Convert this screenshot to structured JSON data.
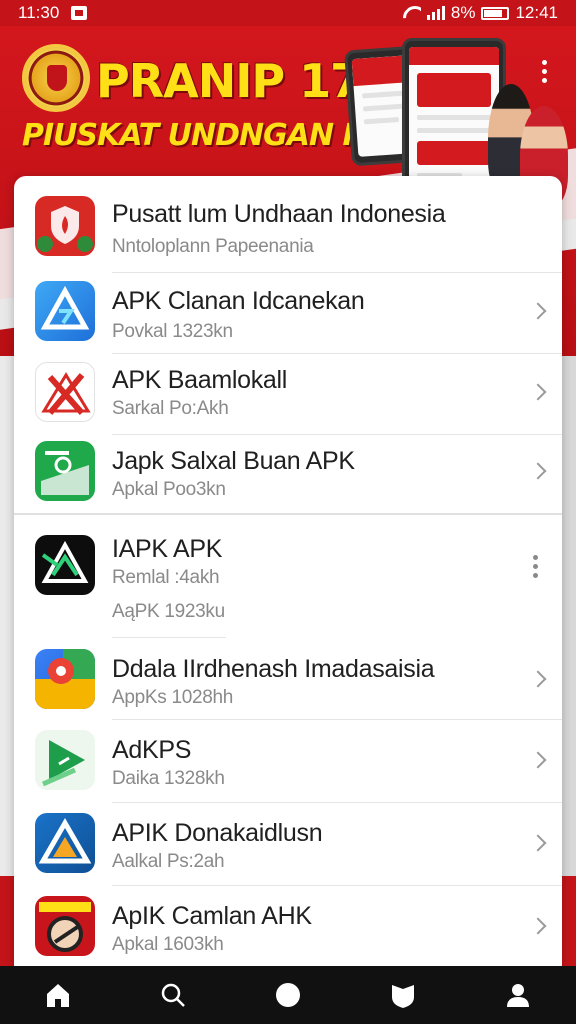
{
  "status_bar": {
    "time": "11:30",
    "battery_text": "8%",
    "clock_right": "12:41"
  },
  "banner": {
    "title": "PRANIP 17",
    "subtitle": "PIUSKAT UNDNGAN IIDONSIN"
  },
  "list": {
    "items": [
      {
        "name": "Pusatt lum Undhaan Indonesia",
        "sub": "Nntoloplann Papeenania",
        "icon": "shield-flame-icon",
        "action": "none"
      },
      {
        "name": "APK Clanan Idcanekan",
        "sub": "Povkal 1323kn",
        "icon": "blue-triangle-app-icon",
        "action": "chevron"
      },
      {
        "name": "APK Baamlokall",
        "sub": "Sarkal Po:Akh",
        "icon": "red-x-app-icon",
        "action": "chevron"
      },
      {
        "name": "Japk Salxal Buan APK",
        "sub": "Apkal Poo3kn",
        "icon": "green-card-app-icon",
        "action": "chevron"
      },
      {
        "name": "IAPK APK",
        "sub": "Remlal :4akh",
        "sub2": "AąPK 1923ku",
        "icon": "dark-triangle-app-icon",
        "action": "kebab"
      },
      {
        "name": "Ddala IIrdhenash Imadasaisia",
        "sub": "AppKs 1028hh",
        "icon": "map-pin-app-icon",
        "action": "chevron"
      },
      {
        "name": "AdKPS",
        "sub": "Daika 1328kh",
        "icon": "green-play-app-icon",
        "action": "chevron"
      },
      {
        "name": "APIK Donakaidlusn",
        "sub": "Aalkal Ps:2ah",
        "icon": "blue-delta-app-icon",
        "action": "chevron"
      },
      {
        "name": "ApIK Camlan AHK",
        "sub": "Apkal 1603kh",
        "icon": "red-poster-app-icon",
        "action": "chevron"
      }
    ]
  },
  "bottom_nav": {
    "items": [
      {
        "icon": "home-icon"
      },
      {
        "icon": "search-icon"
      },
      {
        "icon": "circle-icon"
      },
      {
        "icon": "shield-icon"
      },
      {
        "icon": "profile-icon"
      }
    ]
  },
  "colors": {
    "brand_red": "#c41419",
    "banner_yellow": "#ffe017",
    "nav_bg": "#111111"
  }
}
